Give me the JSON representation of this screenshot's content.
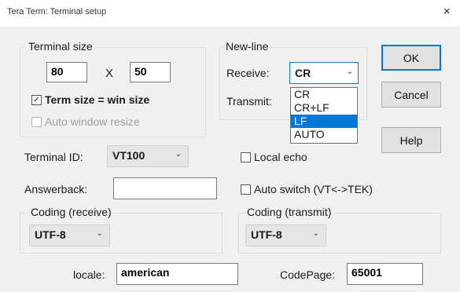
{
  "window": {
    "title": "Tera Term: Terminal setup",
    "close": "×"
  },
  "terminal_size": {
    "label": "Terminal size",
    "cols": "80",
    "times": "X",
    "rows": "50",
    "term_eq_win": {
      "label": "Term size = win size",
      "checked": true
    },
    "auto_resize": {
      "label": "Auto window resize",
      "checked": false,
      "disabled": true
    }
  },
  "newline": {
    "label": "New-line",
    "receive_label": "Receive:",
    "receive_value": "CR",
    "transmit_label": "Transmit:",
    "options": [
      "CR",
      "CR+LF",
      "LF",
      "AUTO"
    ],
    "highlighted": "LF"
  },
  "buttons": {
    "ok": "OK",
    "cancel": "Cancel",
    "help": "Help"
  },
  "terminal_id": {
    "label": "Terminal ID:",
    "value": "VT100"
  },
  "local_echo": {
    "label": "Local echo",
    "checked": false
  },
  "answerback": {
    "label": "Answerback:",
    "value": ""
  },
  "auto_switch": {
    "label": "Auto switch (VT<->TEK)",
    "checked": false
  },
  "coding_receive": {
    "label": "Coding (receive)",
    "value": "UTF-8"
  },
  "coding_transmit": {
    "label": "Coding (transmit)",
    "value": "UTF-8"
  },
  "locale": {
    "label": "locale:",
    "value": "american"
  },
  "codepage": {
    "label": "CodePage:",
    "value": "65001"
  }
}
